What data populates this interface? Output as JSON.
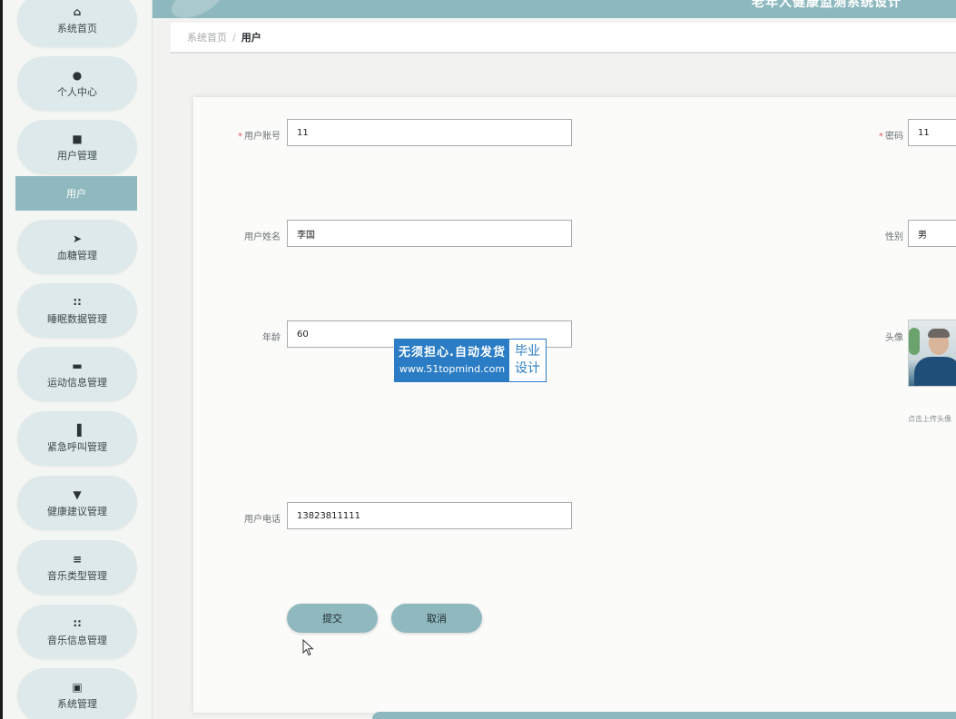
{
  "header": {
    "title": "老年人健康监测系统设计"
  },
  "sidebar": {
    "items": [
      {
        "icon": "home-icon",
        "glyph": "⌂",
        "label": "系统首页"
      },
      {
        "icon": "person-icon",
        "glyph": "●",
        "label": "个人中心"
      },
      {
        "icon": "users-icon",
        "glyph": "■",
        "label": "用户管理"
      },
      {
        "icon": "send-icon",
        "glyph": "➤",
        "label": "血糖管理"
      },
      {
        "icon": "grid-icon",
        "glyph": "∷",
        "label": "睡眠数据管理"
      },
      {
        "icon": "chat-icon",
        "glyph": "▬",
        "label": "运动信息管理"
      },
      {
        "icon": "bar-chart-icon",
        "glyph": "▐",
        "label": "紧急呼叫管理"
      },
      {
        "icon": "filter-icon",
        "glyph": "▼",
        "label": "健康建议管理"
      },
      {
        "icon": "list-icon",
        "glyph": "≡",
        "label": "音乐类型管理"
      },
      {
        "icon": "grid-icon",
        "glyph": "∷",
        "label": "音乐信息管理"
      },
      {
        "icon": "bookmark-icon",
        "glyph": "▣",
        "label": "系统管理"
      }
    ],
    "active_sub": "用户"
  },
  "breadcrumb": {
    "home": "系统首页",
    "separator": "/",
    "current": "用户"
  },
  "form": {
    "account": {
      "label": "用户账号",
      "value": "11"
    },
    "password": {
      "label": "密码",
      "value": "11"
    },
    "name": {
      "label": "用户姓名",
      "value": "李国"
    },
    "gender": {
      "label": "性别",
      "value": "男"
    },
    "age": {
      "label": "年龄",
      "value": "60"
    },
    "avatar": {
      "label": "头像",
      "hint": "点击上传头像"
    },
    "phone": {
      "label": "用户电话",
      "value": "13823811111"
    }
  },
  "buttons": {
    "submit": "提交",
    "cancel": "取消"
  },
  "watermark": {
    "line1": "无须担心.自动发货",
    "line2": "www.51topmind.com",
    "right1": "毕业",
    "right2": "设计"
  },
  "colors": {
    "accent": "#8fb9bf",
    "nav_bg": "#dde9ea",
    "required": "#e25b5b",
    "watermark_blue": "#2a7cc4"
  }
}
